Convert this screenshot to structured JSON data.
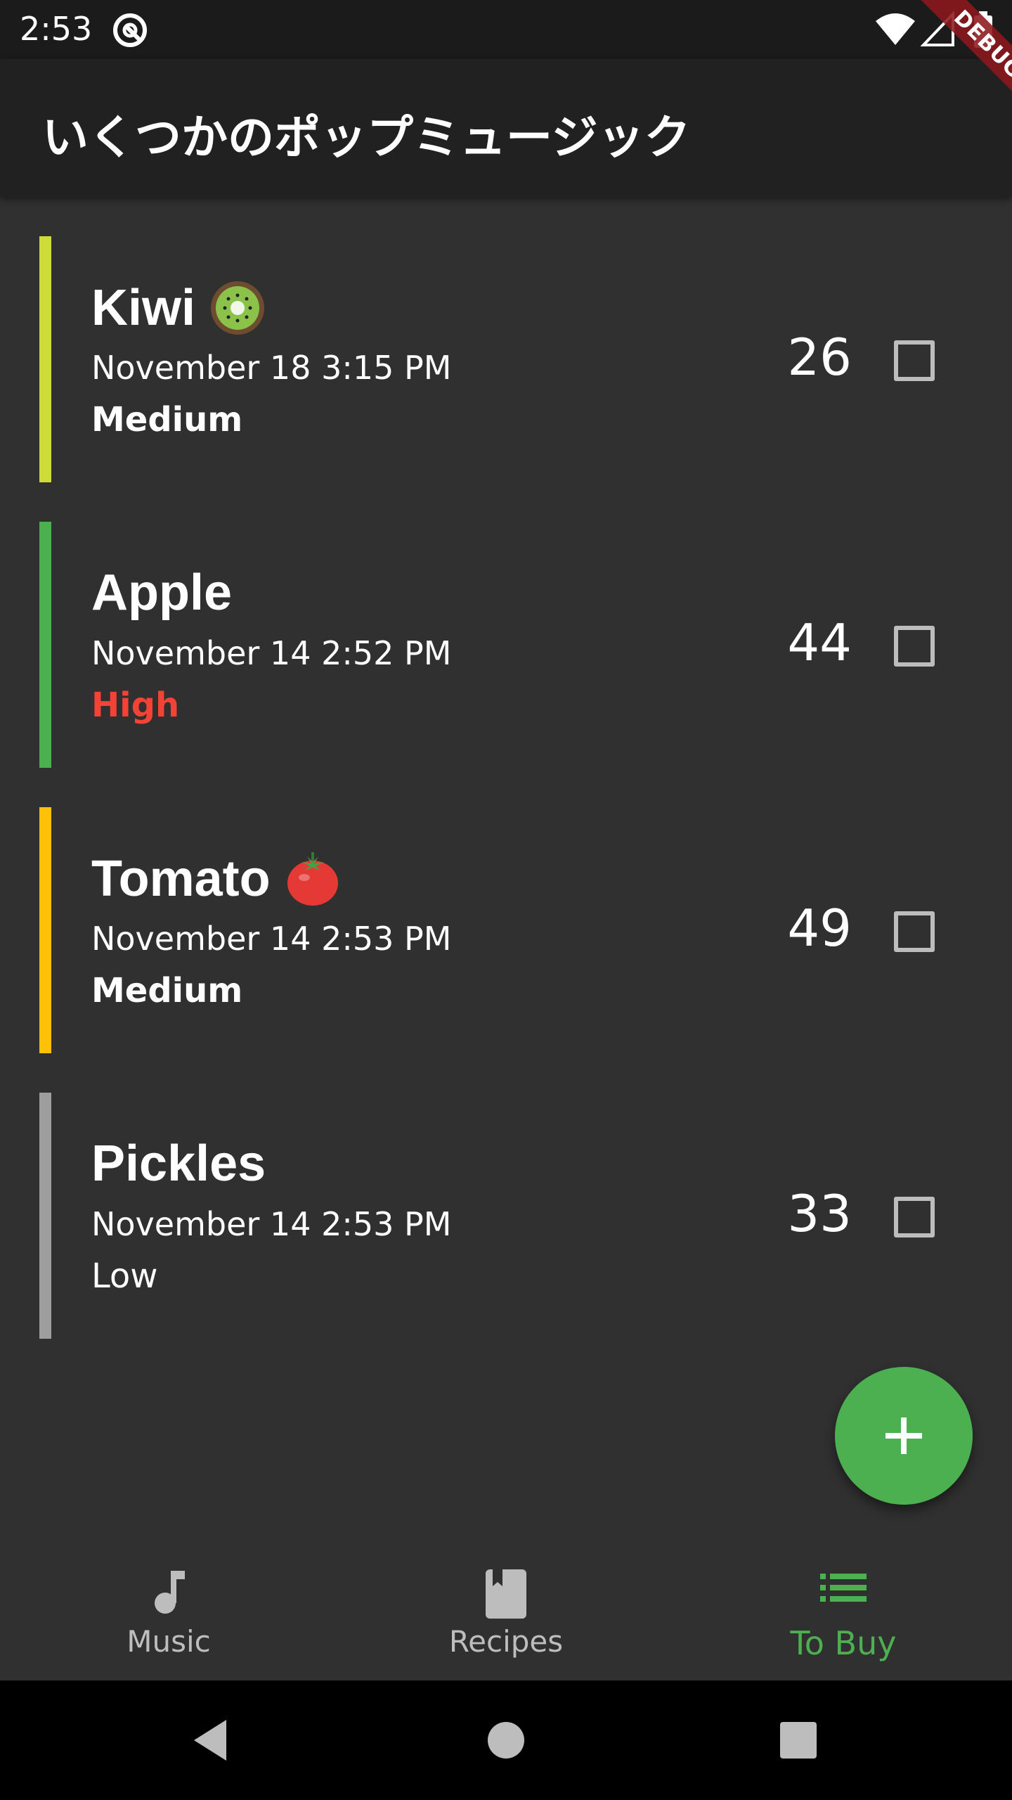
{
  "status_bar": {
    "time": "2:53",
    "icons": [
      "app-notification-icon",
      "wifi-icon",
      "cell-signal-icon",
      "battery-icon"
    ]
  },
  "debug_banner": "DEBUG",
  "app_bar": {
    "title": "いくつかのポップミュージック"
  },
  "items": [
    {
      "name": "Kiwi",
      "emoji": "kiwi-icon",
      "date": "November 18 3:15 PM",
      "priority": "Medium",
      "priority_color": "#ffffff",
      "bar_color": "#cddc39",
      "quantity": "26",
      "checked": false
    },
    {
      "name": "Apple",
      "emoji": "",
      "date": "November 14 2:52 PM",
      "priority": "High",
      "priority_color": "#f44336",
      "bar_color": "#4caf50",
      "quantity": "44",
      "checked": false
    },
    {
      "name": "Tomato",
      "emoji": "tomato-icon",
      "date": "November 14 2:53 PM",
      "priority": "Medium",
      "priority_color": "#ffffff",
      "bar_color": "#ffc107",
      "quantity": "49",
      "checked": false
    },
    {
      "name": "Pickles",
      "emoji": "",
      "date": "November 14 2:53 PM",
      "priority": "Low",
      "priority_color": "#ffffff",
      "bar_color": "#9e9e9e",
      "quantity": "33",
      "checked": false
    }
  ],
  "fab": {
    "icon": "plus-icon",
    "color": "#4caf50"
  },
  "bottom_nav": {
    "items": [
      {
        "label": "Music",
        "icon": "music-note-icon",
        "active": false
      },
      {
        "label": "Recipes",
        "icon": "book-icon",
        "active": false
      },
      {
        "label": "To Buy",
        "icon": "list-icon",
        "active": true
      }
    ],
    "active_color": "#4caf50",
    "inactive_color": "#bdbdbd"
  },
  "system_nav": {
    "icons": [
      "back-icon",
      "home-icon",
      "recents-icon"
    ]
  }
}
